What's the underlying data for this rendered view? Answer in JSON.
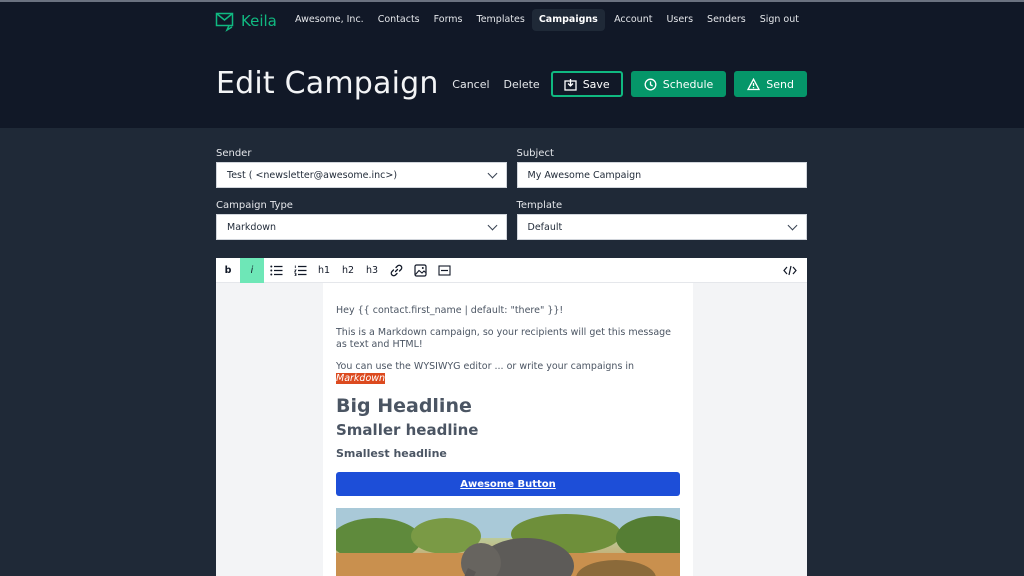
{
  "brand": {
    "name": "Keila"
  },
  "nav": {
    "left": [
      "Awesome, Inc.",
      "Contacts",
      "Forms",
      "Templates",
      "Campaigns"
    ],
    "active": "Campaigns",
    "right": [
      "Account",
      "Users",
      "Senders",
      "Sign out"
    ]
  },
  "page": {
    "title": "Edit Campaign",
    "actions": {
      "cancel": "Cancel",
      "delete": "Delete",
      "save": "Save",
      "schedule": "Schedule",
      "send": "Send"
    }
  },
  "form": {
    "sender": {
      "label": "Sender",
      "value": "Test ( <newsletter@awesome.inc>)"
    },
    "subject": {
      "label": "Subject",
      "value": "My Awesome Campaign"
    },
    "campaign_type": {
      "label": "Campaign Type",
      "value": "Markdown"
    },
    "template": {
      "label": "Template",
      "value": "Default"
    }
  },
  "toolbar": {
    "bold": "b",
    "italic": "i",
    "h1": "h1",
    "h2": "h2",
    "h3": "h3",
    "icons": [
      "bullet-list-icon",
      "numbered-list-icon",
      "link-icon",
      "image-icon",
      "divider-icon",
      "code-view-icon"
    ],
    "active": "italic"
  },
  "content": {
    "greeting": "Hey {{ contact.first_name | default: \"there\" }}!",
    "intro": "This is a Markdown campaign, so your recipients will get this message as text and HTML!",
    "wysiwyg_text": "You can use the WYSIWYG editor ... or write your campaigns in ",
    "markdown_word": "Markdown",
    "big_headline": "Big Headline",
    "smaller_headline": "Smaller headline",
    "smallest_headline": "Smallest headline",
    "button_label": "Awesome Button"
  },
  "colors": {
    "header_bg": "#111827",
    "body_bg": "#1f2937",
    "accent": "#10b981",
    "accent_solid": "#059669",
    "cta": "#1d4ed8",
    "highlight": "#dc4a1f"
  }
}
